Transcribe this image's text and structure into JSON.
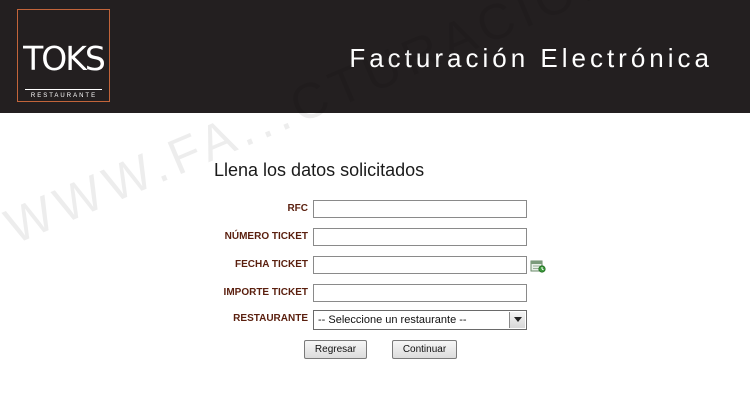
{
  "header": {
    "logo_text": "TOKS",
    "logo_subtext": "RESTAURANTE",
    "title": "Facturación Electrónica"
  },
  "watermark": "WWW.FA...CTURACIONELECTRONICA.COM.MX",
  "form": {
    "title": "Llena los datos solicitados",
    "fields": {
      "rfc": {
        "label": "RFC",
        "value": ""
      },
      "ticket_number": {
        "label": "NÚMERO TICKET",
        "value": ""
      },
      "ticket_date": {
        "label": "FECHA TICKET",
        "value": ""
      },
      "ticket_amount": {
        "label": "IMPORTE TICKET",
        "value": ""
      },
      "restaurant": {
        "label": "RESTAURANTE",
        "selected": "-- Seleccione un restaurante --"
      }
    },
    "buttons": {
      "back": "Regresar",
      "continue": "Continuar"
    }
  },
  "colors": {
    "header_bg": "#231f20",
    "logo_border": "#c2643a",
    "label_color": "#5a1f0e"
  }
}
